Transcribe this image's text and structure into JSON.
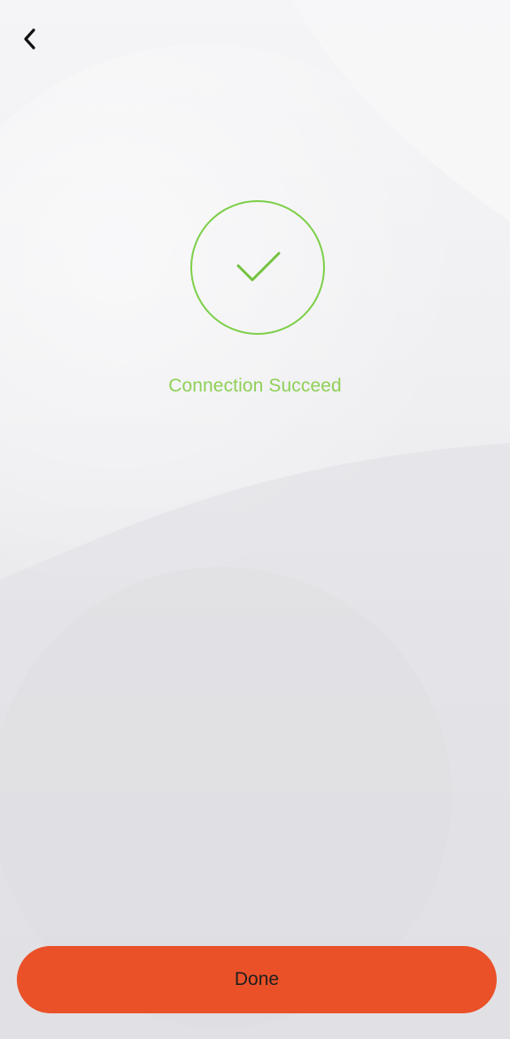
{
  "header": {
    "back_icon": "chevron-left-icon"
  },
  "status": {
    "icon": "checkmark-icon",
    "message": "Connection Succeed",
    "accent_color": "#7ccf48"
  },
  "actions": {
    "done_label": "Done",
    "done_color": "#ea5129"
  }
}
